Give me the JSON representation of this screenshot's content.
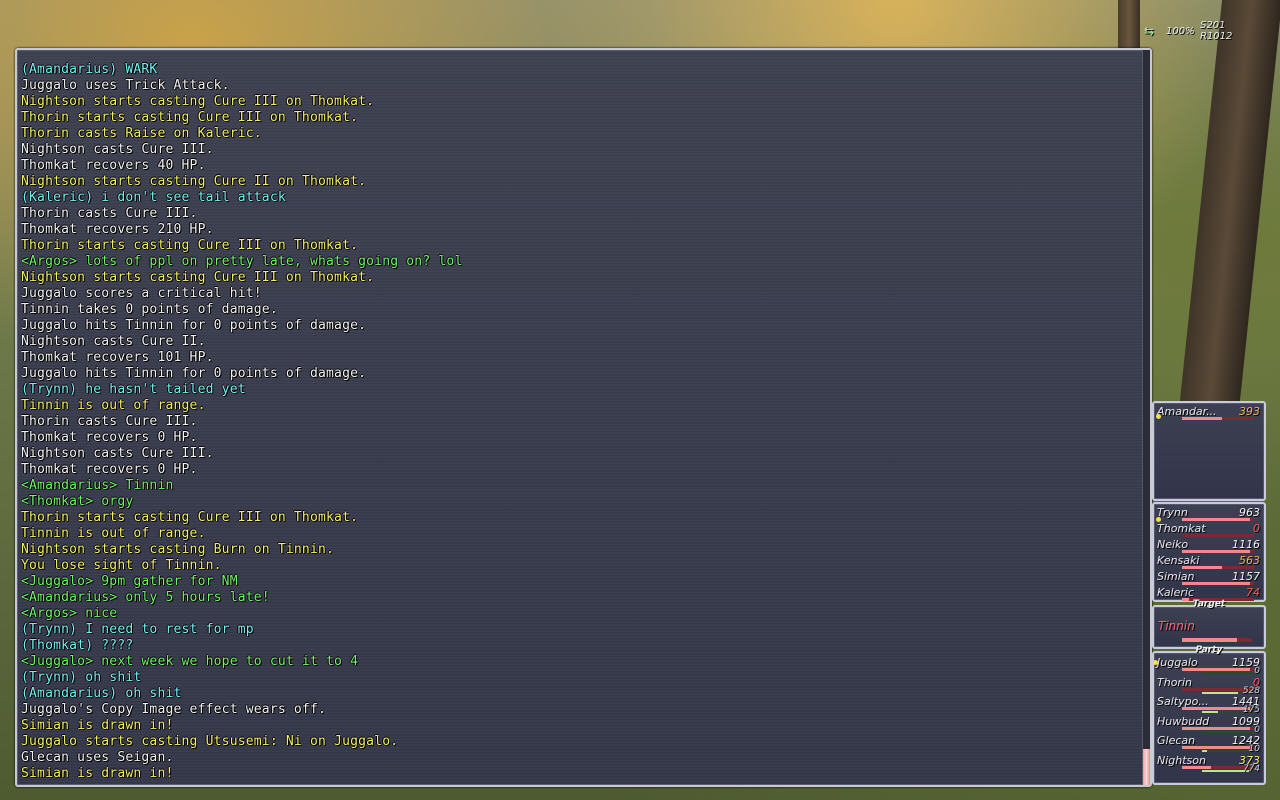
{
  "hud": {
    "compass_icon": "compass-icon",
    "percent": "100%",
    "s": "S201",
    "r": "R1012"
  },
  "chat": {
    "lines": [
      {
        "text": "(Amandarius) WARK",
        "color": "cyan"
      },
      {
        "text": "Juggalo uses Trick Attack.",
        "color": "white"
      },
      {
        "text": "Nightson starts casting Cure III on Thomkat.",
        "color": "yellow"
      },
      {
        "text": "Thorin starts casting Cure III on Thomkat.",
        "color": "yellow"
      },
      {
        "text": "Thorin casts Raise on Kaleric.",
        "color": "yellow"
      },
      {
        "text": "Nightson casts Cure III.",
        "color": "white"
      },
      {
        "text": "Thomkat recovers 40 HP.",
        "color": "white"
      },
      {
        "text": "Nightson starts casting Cure II on Thomkat.",
        "color": "yellow"
      },
      {
        "text": "(Kaleric) i don't see tail attack",
        "color": "cyan"
      },
      {
        "text": "Thorin casts Cure III.",
        "color": "white"
      },
      {
        "text": "Thomkat recovers 210 HP.",
        "color": "white"
      },
      {
        "text": "Thorin starts casting Cure III on Thomkat.",
        "color": "yellow"
      },
      {
        "text": "<Argos> lots of ppl on pretty late, whats going on? lol",
        "color": "green"
      },
      {
        "text": "Nightson starts casting Cure III on Thomkat.",
        "color": "yellow"
      },
      {
        "text": "Juggalo scores a critical hit!",
        "color": "white"
      },
      {
        "text": "Tinnin takes 0 points of damage.",
        "color": "white"
      },
      {
        "text": "Juggalo hits Tinnin for 0 points of damage.",
        "color": "white"
      },
      {
        "text": "Nightson casts Cure II.",
        "color": "white"
      },
      {
        "text": "Thomkat recovers 101 HP.",
        "color": "white"
      },
      {
        "text": "Juggalo hits Tinnin for 0 points of damage.",
        "color": "white"
      },
      {
        "text": "(Trynn) he hasn't tailed yet",
        "color": "cyan"
      },
      {
        "text": "Tinnin is out of range.",
        "color": "yellow"
      },
      {
        "text": "Thorin casts Cure III.",
        "color": "white"
      },
      {
        "text": "Thomkat recovers 0 HP.",
        "color": "white"
      },
      {
        "text": "Nightson casts Cure III.",
        "color": "white"
      },
      {
        "text": "Thomkat recovers 0 HP.",
        "color": "white"
      },
      {
        "text": "<Amandarius> Tinnin",
        "color": "green"
      },
      {
        "text": "<Thomkat> orgy",
        "color": "green"
      },
      {
        "text": "Thorin starts casting Cure III on Thomkat.",
        "color": "yellow"
      },
      {
        "text": "Tinnin is out of range.",
        "color": "yellow"
      },
      {
        "text": "Nightson starts casting Burn on Tinnin.",
        "color": "yellow"
      },
      {
        "text": "You lose sight of Tinnin.",
        "color": "yellow"
      },
      {
        "text": "<Juggalo> 9pm gather for NM",
        "color": "green"
      },
      {
        "text": "<Amandarius> only 5 hours late!",
        "color": "green"
      },
      {
        "text": "<Argos> nice",
        "color": "green"
      },
      {
        "text": "(Trynn) I need to rest for mp",
        "color": "cyan"
      },
      {
        "text": "(Thomkat) ????",
        "color": "cyan"
      },
      {
        "text": "<Juggalo> next week we hope to cut it to 4",
        "color": "green"
      },
      {
        "text": "(Trynn) oh shit",
        "color": "cyan"
      },
      {
        "text": "(Amandarius) oh shit",
        "color": "cyan"
      },
      {
        "text": "Juggalo's Copy Image effect wears off.",
        "color": "white"
      },
      {
        "text": "Simian is drawn in!",
        "color": "yellow"
      },
      {
        "text": "Juggalo starts casting Utsusemi: Ni on Juggalo.",
        "color": "yellow"
      },
      {
        "text": "Glecan uses Seigan.",
        "color": "white"
      },
      {
        "text": "Simian is drawn in!",
        "color": "yellow"
      }
    ],
    "scroll_position": 1.0
  },
  "alliance1": {
    "members": [
      {
        "name": "Amandar...",
        "hp": "393",
        "hp_color": "orange",
        "hp_fraction": 0.55
      }
    ]
  },
  "alliance2": {
    "members": [
      {
        "name": "Trynn",
        "hp": "963",
        "hp_color": "white",
        "hp_fraction": 0.95
      },
      {
        "name": "Thomkat",
        "hp": "0",
        "hp_color": "red",
        "hp_fraction": 0.0
      },
      {
        "name": "Neiko",
        "hp": "1116",
        "hp_color": "white",
        "hp_fraction": 0.95
      },
      {
        "name": "Kensaki",
        "hp": "563",
        "hp_color": "orange",
        "hp_fraction": 0.55
      },
      {
        "name": "Simian",
        "hp": "1157",
        "hp_color": "white",
        "hp_fraction": 0.95
      },
      {
        "name": "Kaleric",
        "hp": "74",
        "hp_color": "red",
        "hp_fraction": 0.1
      }
    ]
  },
  "target": {
    "title": "Target",
    "name": "Tinnin",
    "hp_fraction": 0.78
  },
  "party": {
    "title": "Party",
    "members": [
      {
        "name": "Juggalo",
        "hp": "1159",
        "tp": "0",
        "hp_color": "white",
        "hp_fraction": 0.95,
        "mp_fraction": 0.0
      },
      {
        "name": "Thorin",
        "hp": "0",
        "tp": "528",
        "hp_color": "red",
        "hp_fraction": 0.0,
        "mp_fraction": 0.7
      },
      {
        "name": "Saltypo...",
        "hp": "1441",
        "tp": "175",
        "hp_color": "white",
        "hp_fraction": 0.95,
        "mp_fraction": 0.3
      },
      {
        "name": "Huwbudd",
        "hp": "1099",
        "tp": "0",
        "hp_color": "white",
        "hp_fraction": 0.95,
        "mp_fraction": 0.0
      },
      {
        "name": "Glecan",
        "hp": "1242",
        "tp": "10",
        "hp_color": "white",
        "hp_fraction": 0.95,
        "mp_fraction": 0.1
      },
      {
        "name": "Nightson",
        "hp": "373",
        "tp": "774",
        "hp_color": "yellow",
        "hp_fraction": 0.4,
        "mp_fraction": 0.9
      }
    ]
  }
}
